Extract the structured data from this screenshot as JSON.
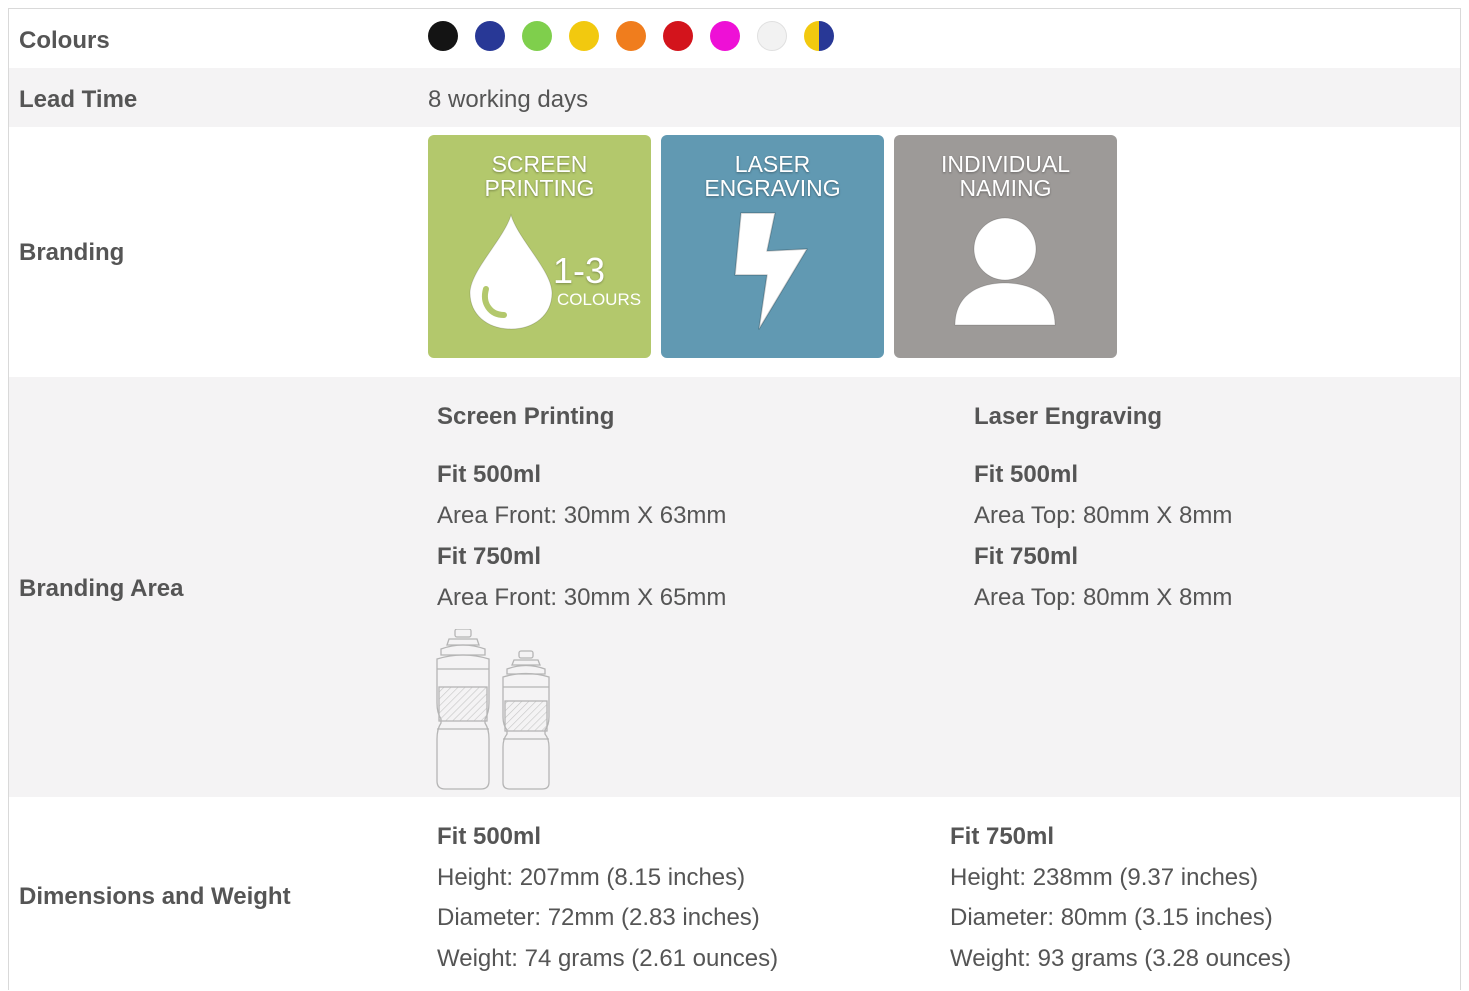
{
  "rows": {
    "colours": {
      "label": "Colours",
      "swatches": [
        {
          "name": "black",
          "color": "#141414"
        },
        {
          "name": "navy",
          "color": "#283896"
        },
        {
          "name": "green",
          "color": "#7fcf4c"
        },
        {
          "name": "yellow",
          "color": "#f2c90f"
        },
        {
          "name": "orange",
          "color": "#f07d1d"
        },
        {
          "name": "red",
          "color": "#d3141c"
        },
        {
          "name": "magenta",
          "color": "#ee10d6"
        },
        {
          "name": "white",
          "color": "#f2f2f2"
        },
        {
          "name": "yellow-navy",
          "color": "#f2c90f",
          "color2": "#283896"
        }
      ]
    },
    "lead_time": {
      "label": "Lead Time",
      "value": "8 working days"
    },
    "branding": {
      "label": "Branding",
      "tiles": [
        {
          "line1": "SCREEN",
          "line2": "PRINTING",
          "range": "1-3",
          "unit": "COLOURS",
          "icon": "drop-icon",
          "color": "#b3c86c"
        },
        {
          "line1": "LASER",
          "line2": "ENGRAVING",
          "icon": "lightning-bolt-icon",
          "color": "#6199b2"
        },
        {
          "line1": "INDIVIDUAL",
          "line2": "NAMING",
          "icon": "person-icon",
          "color": "#9d9a98"
        }
      ]
    },
    "branding_area": {
      "label": "Branding Area",
      "screen": {
        "heading": "Screen Printing",
        "fit1": "Fit 500ml",
        "area1": "Area Front: 30mm X 63mm",
        "fit2": "Fit 750ml",
        "area2": "Area Front: 30mm X 65mm"
      },
      "laser": {
        "heading": "Laser Engraving",
        "fit1": "Fit 500ml",
        "area1": "Area Top: 80mm X 8mm",
        "fit2": "Fit 750ml",
        "area2": "Area Top: 80mm X 8mm"
      }
    },
    "dimensions": {
      "label": "Dimensions and Weight",
      "fit500": {
        "heading": "Fit 500ml",
        "height": "Height: 207mm (8.15 inches)",
        "diameter": "Diameter: 72mm (2.83 inches)",
        "weight": "Weight: 74 grams (2.61 ounces)"
      },
      "fit750": {
        "heading": "Fit 750ml",
        "height": "Height: 238mm (9.37 inches)",
        "diameter": "Diameter: 80mm (3.15 inches)",
        "weight": "Weight: 93 grams (3.28 ounces)"
      }
    }
  }
}
